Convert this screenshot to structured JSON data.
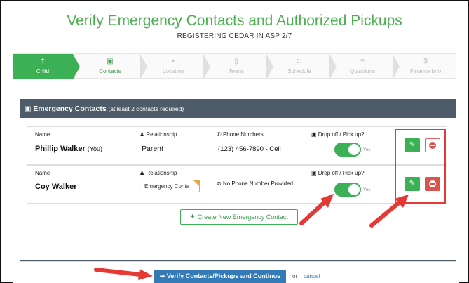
{
  "header": {
    "title": "Verify Emergency Contacts and Authorized Pickups",
    "subtitle": "REGISTERING CEDAR IN ASP 2/7"
  },
  "steps": [
    {
      "label": "Child",
      "icon": "person-icon",
      "glyph": "†",
      "state": "done"
    },
    {
      "label": "Contacts",
      "icon": "contacts-icon",
      "glyph": "▣",
      "state": "active"
    },
    {
      "label": "Location",
      "icon": "map-marker-icon",
      "glyph": "•",
      "state": "pending"
    },
    {
      "label": "Terms",
      "icon": "document-icon",
      "glyph": "▯",
      "state": "pending"
    },
    {
      "label": "Schedule",
      "icon": "calendar-icon",
      "glyph": "□",
      "state": "pending"
    },
    {
      "label": "Questions",
      "icon": "list-icon",
      "glyph": "≡",
      "state": "pending"
    },
    {
      "label": "Finance Info",
      "icon": "dollar-icon",
      "glyph": "$",
      "state": "pending"
    }
  ],
  "panel": {
    "title": "Emergency Contacts",
    "note": "(at least 2 contacts required)",
    "columns": {
      "name": "Name",
      "relationship": "Relationship",
      "phones": "Phone Numbers",
      "pickup": "Drop off / Pick up?"
    }
  },
  "contacts": [
    {
      "name": "Phillip Walker",
      "name_suffix": "(You)",
      "relationship": "Parent",
      "phone": "(123) 456-7890 - Cell",
      "pickup": true,
      "pickup_label": "Yes"
    },
    {
      "name": "Coy Walker",
      "name_suffix": "",
      "relationship": "Emergency Conta",
      "phone": "No Phone Number Provided",
      "pickup": true,
      "pickup_label": "Yes"
    }
  ],
  "actions": {
    "create_contact": "Create New Emergency Contact",
    "verify": "Verify Contacts/Pickups and Continue",
    "or": "or",
    "cancel": "cancel"
  },
  "colors": {
    "accent_green": "#3cb054",
    "title_green": "#4caf50",
    "panel_header": "#4e5b68",
    "primary_blue": "#337ab7",
    "danger_red": "#d9534f",
    "annotation_red": "#e53935"
  }
}
